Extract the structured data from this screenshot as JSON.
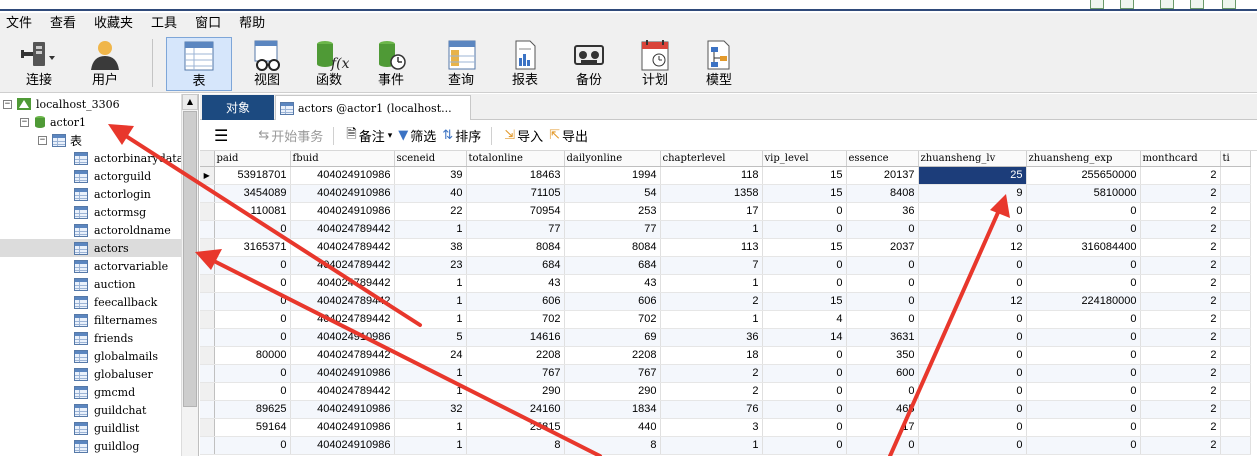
{
  "menu": [
    "文件",
    "查看",
    "收藏夹",
    "工具",
    "窗口",
    "帮助"
  ],
  "toolbar": {
    "connect": "连接",
    "user": "用户",
    "table": "表",
    "view": "视图",
    "function": "函数",
    "event": "事件",
    "query": "查询",
    "report": "报表",
    "backup": "备份",
    "schedule": "计划",
    "model": "模型"
  },
  "tree": {
    "server": "localhost_3306",
    "database": "actor1",
    "tables_folder": "表",
    "tables": [
      "actorbinarydata",
      "actorguild",
      "actorlogin",
      "actormsg",
      "actoroldname",
      "actors",
      "actorvariable",
      "auction",
      "feecallback",
      "filternames",
      "friends",
      "globalmails",
      "globaluser",
      "gmcmd",
      "guildchat",
      "guildlist",
      "guildlog"
    ],
    "selected": "actors"
  },
  "tabs": {
    "objects": "对象",
    "actors": "actors @actor1 (localhost..."
  },
  "subtoolbar": {
    "begin_tx": "开始事务",
    "note": "备注",
    "filter": "筛选",
    "sort": "排序",
    "import": "导入",
    "export": "导出"
  },
  "grid": {
    "columns": [
      "paid",
      "fbuid",
      "sceneid",
      "totalonline",
      "dailyonline",
      "chapterlevel",
      "vip_level",
      "essence",
      "zhuansheng_lv",
      "zhuansheng_exp",
      "monthcard",
      "ti"
    ],
    "rows": [
      [
        "53918701",
        "404024910986",
        "39",
        "18463",
        "1994",
        "118",
        "15",
        "20137",
        "25",
        "255650000",
        "2",
        ""
      ],
      [
        "3454089",
        "404024910986",
        "40",
        "71105",
        "54",
        "1358",
        "15",
        "8408",
        "9",
        "5810000",
        "2",
        ""
      ],
      [
        "110081",
        "404024910986",
        "22",
        "70954",
        "253",
        "17",
        "0",
        "36",
        "0",
        "0",
        "2",
        ""
      ],
      [
        "0",
        "404024789442",
        "1",
        "77",
        "77",
        "1",
        "0",
        "0",
        "0",
        "0",
        "2",
        ""
      ],
      [
        "3165371",
        "404024789442",
        "38",
        "8084",
        "8084",
        "113",
        "15",
        "2037",
        "12",
        "316084400",
        "2",
        ""
      ],
      [
        "0",
        "404024789442",
        "23",
        "684",
        "684",
        "7",
        "0",
        "0",
        "0",
        "0",
        "2",
        ""
      ],
      [
        "0",
        "404024789442",
        "1",
        "43",
        "43",
        "1",
        "0",
        "0",
        "0",
        "0",
        "2",
        ""
      ],
      [
        "0",
        "404024789442",
        "1",
        "606",
        "606",
        "2",
        "15",
        "0",
        "12",
        "224180000",
        "2",
        ""
      ],
      [
        "0",
        "404024789442",
        "1",
        "702",
        "702",
        "1",
        "4",
        "0",
        "0",
        "0",
        "2",
        ""
      ],
      [
        "0",
        "404024910986",
        "5",
        "14616",
        "69",
        "36",
        "14",
        "3631",
        "0",
        "0",
        "2",
        ""
      ],
      [
        "80000",
        "404024789442",
        "24",
        "2208",
        "2208",
        "18",
        "0",
        "350",
        "0",
        "0",
        "2",
        ""
      ],
      [
        "0",
        "404024910986",
        "1",
        "767",
        "767",
        "2",
        "0",
        "600",
        "0",
        "0",
        "2",
        ""
      ],
      [
        "0",
        "404024789442",
        "1",
        "290",
        "290",
        "2",
        "0",
        "0",
        "0",
        "0",
        "2",
        ""
      ],
      [
        "89625",
        "404024910986",
        "32",
        "24160",
        "1834",
        "76",
        "0",
        "465",
        "0",
        "0",
        "2",
        ""
      ],
      [
        "59164",
        "404024910986",
        "1",
        "25815",
        "440",
        "3",
        "0",
        "17",
        "0",
        "0",
        "2",
        ""
      ],
      [
        "0",
        "404024910986",
        "1",
        "8",
        "8",
        "1",
        "0",
        "0",
        "0",
        "0",
        "2",
        ""
      ]
    ]
  },
  "colors": {
    "highlight": "#1c3d7a",
    "tab_active": "#1c4a80",
    "arrow": "#e8372c"
  }
}
